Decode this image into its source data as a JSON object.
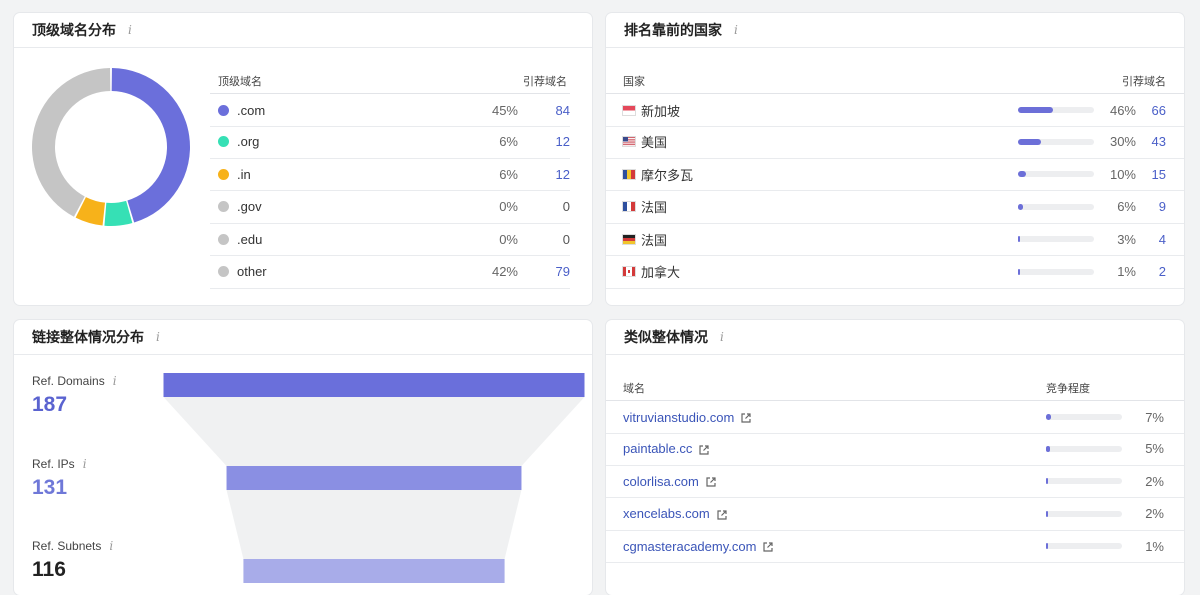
{
  "tld": {
    "title": "顶级域名分布",
    "col_domain": "顶级域名",
    "col_ref": "引荐域名",
    "rows": [
      {
        "name": ".com",
        "pct": "45%",
        "count": "84",
        "color": "#6b6fdb"
      },
      {
        "name": ".org",
        "pct": "6%",
        "count": "12",
        "color": "#36e0b5"
      },
      {
        "name": ".in",
        "pct": "6%",
        "count": "12",
        "color": "#f7b21a"
      },
      {
        "name": ".gov",
        "pct": "0%",
        "count": "0",
        "color": "#c5c5c5"
      },
      {
        "name": ".edu",
        "pct": "0%",
        "count": "0",
        "color": "#c5c5c5"
      },
      {
        "name": "other",
        "pct": "42%",
        "count": "79",
        "color": "#c5c5c5"
      }
    ],
    "donut": [
      45,
      6,
      6,
      0,
      0,
      42
    ]
  },
  "countries": {
    "title": "排名靠前的国家",
    "col_country": "国家",
    "col_ref": "引荐域名",
    "rows": [
      {
        "name": "新加坡",
        "pct": "46%",
        "count": "66",
        "level": 0.46,
        "flag": "sg-flag-icon"
      },
      {
        "name": "美国",
        "pct": "30%",
        "count": "43",
        "level": 0.3,
        "flag": "us-flag-icon"
      },
      {
        "name": "摩尔多瓦",
        "pct": "10%",
        "count": "15",
        "level": 0.1,
        "flag": "md-flag-icon"
      },
      {
        "name": "法国",
        "pct": "6%",
        "count": "9",
        "level": 0.06,
        "flag": "fr-flag-icon"
      },
      {
        "name": "法国",
        "pct": "3%",
        "count": "4",
        "level": 0.03,
        "flag": "de-flag-icon"
      },
      {
        "name": "加拿大",
        "pct": "1%",
        "count": "2",
        "level": 0.01,
        "flag": "ca-flag-icon"
      }
    ]
  },
  "links": {
    "title": "链接整体情况分布",
    "metrics": [
      {
        "label": "Ref. Domains",
        "value": "187",
        "color": "#5a63d0"
      },
      {
        "label": "Ref. IPs",
        "value": "131",
        "color": "#6f78d8"
      },
      {
        "label": "Ref. Subnets",
        "value": "116",
        "color": "#222222"
      }
    ],
    "funnel_values": [
      187,
      131,
      116
    ]
  },
  "similar": {
    "title": "类似整体情况",
    "col_domain": "域名",
    "col_comp": "竞争程度",
    "rows": [
      {
        "domain": "vitruvianstudio.com",
        "pct": "7%",
        "level": 0.07
      },
      {
        "domain": "paintable.cc",
        "pct": "5%",
        "level": 0.05
      },
      {
        "domain": "colorlisa.com",
        "pct": "2%",
        "level": 0.02
      },
      {
        "domain": "xencelabs.com",
        "pct": "2%",
        "level": 0.02
      },
      {
        "domain": "cgmasteracademy.com",
        "pct": "1%",
        "level": 0.01
      }
    ]
  },
  "info_glyph": "i"
}
